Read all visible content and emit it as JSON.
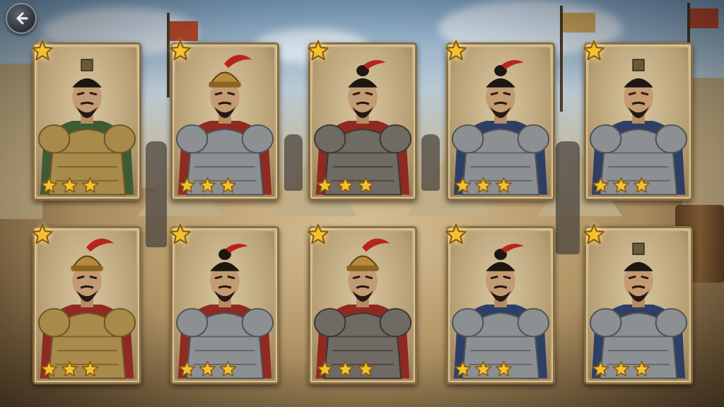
{
  "screen": {
    "back_button_icon": "back-arrow-icon",
    "corner_badge_icon": "star-icon"
  },
  "colors": {
    "star_gold": "#f2c230",
    "star_outline": "#8a5a10",
    "card_border": "#8a6d3e",
    "helmet_plume_red": "#b8241c"
  },
  "cards": [
    {
      "id": "general-1",
      "row": 1,
      "col": 1,
      "stars": 3,
      "headgear": "topknot-crown",
      "armor": "gold",
      "robe": "green"
    },
    {
      "id": "general-2",
      "row": 1,
      "col": 2,
      "stars": 3,
      "headgear": "plumed-helmet",
      "armor": "steel",
      "robe": "red"
    },
    {
      "id": "general-3",
      "row": 1,
      "col": 3,
      "stars": 3,
      "headgear": "topknot-plume",
      "armor": "dark-steel",
      "robe": "red"
    },
    {
      "id": "general-4",
      "row": 1,
      "col": 4,
      "stars": 3,
      "headgear": "topknot-plume",
      "armor": "steel",
      "robe": "blue"
    },
    {
      "id": "general-5",
      "row": 1,
      "col": 5,
      "stars": 3,
      "headgear": "topknot-crown",
      "armor": "steel",
      "robe": "blue"
    },
    {
      "id": "general-6",
      "row": 2,
      "col": 1,
      "stars": 3,
      "headgear": "plumed-helmet",
      "armor": "gold",
      "robe": "red"
    },
    {
      "id": "general-7",
      "row": 2,
      "col": 2,
      "stars": 3,
      "headgear": "topknot-plume",
      "armor": "steel",
      "robe": "red"
    },
    {
      "id": "general-8",
      "row": 2,
      "col": 3,
      "stars": 3,
      "headgear": "plumed-helmet",
      "armor": "dark-steel",
      "robe": "red"
    },
    {
      "id": "general-9",
      "row": 2,
      "col": 4,
      "stars": 3,
      "headgear": "topknot-plume",
      "armor": "steel",
      "robe": "blue"
    },
    {
      "id": "general-10",
      "row": 2,
      "col": 5,
      "stars": 3,
      "headgear": "topknot-crown",
      "armor": "steel",
      "robe": "blue"
    }
  ]
}
